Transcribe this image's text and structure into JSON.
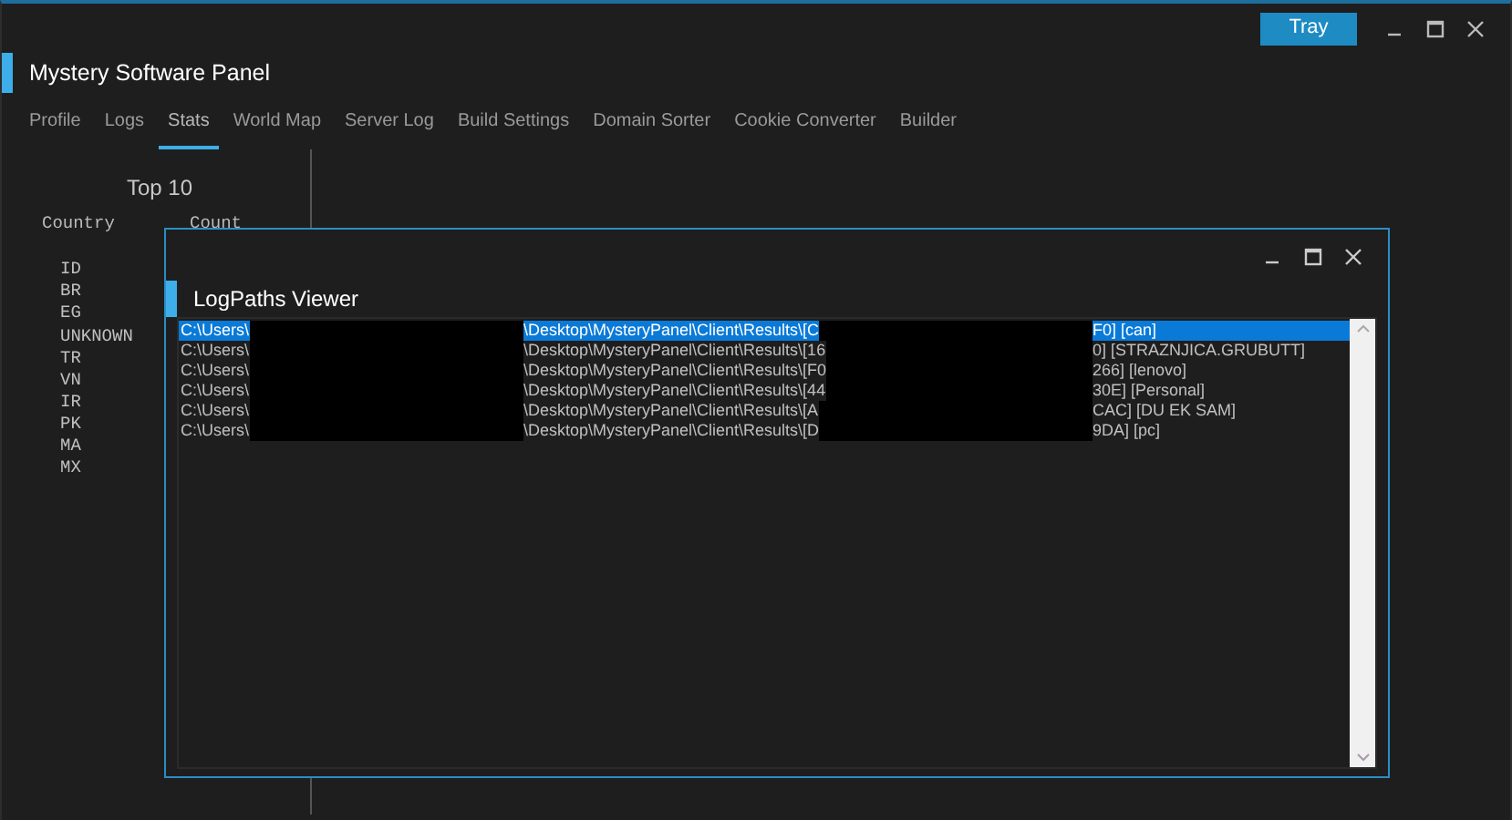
{
  "window": {
    "tray_button": "Tray",
    "title": "Mystery Software Panel"
  },
  "tabs": [
    {
      "label": "Profile",
      "selected": false
    },
    {
      "label": "Logs",
      "selected": false
    },
    {
      "label": "Stats",
      "selected": true
    },
    {
      "label": "World Map",
      "selected": false
    },
    {
      "label": "Server Log",
      "selected": false
    },
    {
      "label": "Build Settings",
      "selected": false
    },
    {
      "label": "Domain Sorter",
      "selected": false
    },
    {
      "label": "Cookie Converter",
      "selected": false
    },
    {
      "label": "Builder",
      "selected": false
    }
  ],
  "top10": {
    "title": "Top 10",
    "columns": [
      "Country",
      "Count"
    ],
    "countries": [
      "ID",
      "BR",
      "EG",
      "UNKNOWN",
      "TR",
      "VN",
      "IR",
      "PK",
      "MA",
      "MX"
    ]
  },
  "dialog": {
    "title": "LogPaths Viewer",
    "rows": [
      {
        "parts": [
          "C:\\Users\\",
          "\\Desktop\\MysteryPanel\\Client\\Results\\[C",
          "F0] [can]"
        ],
        "selected": true
      },
      {
        "parts": [
          "C:\\Users\\",
          "\\Desktop\\MysteryPanel\\Client\\Results\\[16",
          "0] [STRAZNJICA.GRUBUTT]"
        ],
        "selected": false
      },
      {
        "parts": [
          "C:\\Users\\",
          "\\Desktop\\MysteryPanel\\Client\\Results\\[F0",
          "266] [lenovo]"
        ],
        "selected": false
      },
      {
        "parts": [
          "C:\\Users\\",
          "\\Desktop\\MysteryPanel\\Client\\Results\\[44",
          "30E] [Personal]"
        ],
        "selected": false
      },
      {
        "parts": [
          "C:\\Users\\",
          "\\Desktop\\MysteryPanel\\Client\\Results\\[A",
          "CAC] [DU EK SAM]"
        ],
        "selected": false
      },
      {
        "parts": [
          "C:\\Users\\",
          "\\Desktop\\MysteryPanel\\Client\\Results\\[D",
          "9DA] [pc]"
        ],
        "selected": false
      }
    ]
  }
}
